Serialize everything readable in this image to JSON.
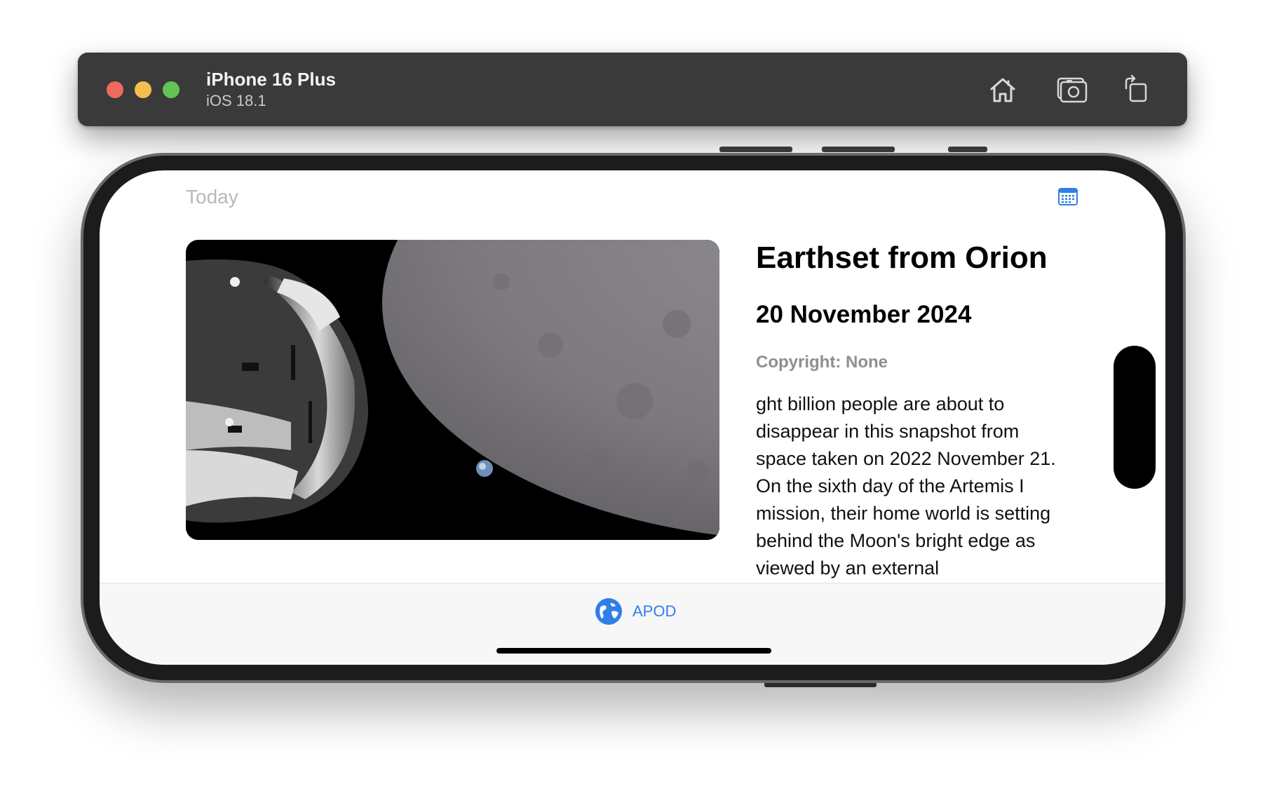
{
  "simulator": {
    "device_name": "iPhone 16 Plus",
    "os_version": "iOS 18.1",
    "buttons": {
      "home_icon": "home-icon",
      "screenshot_icon": "camera-icon",
      "rotate_icon": "rotate-icon"
    },
    "traffic_lights": {
      "close_color": "#ed6a5e",
      "minimize_color": "#f4bf4f",
      "zoom_color": "#61c454"
    }
  },
  "app": {
    "nav": {
      "title": "Today",
      "calendar_icon": "calendar-icon"
    },
    "apod": {
      "title": "Earthset from Orion",
      "date": "20 November 2024",
      "copyright": "Copyright: None",
      "explanation": "ght billion people are about to disappear in this snapshot from space taken on 2022 November 21. On the sixth day of the Artemis I mission, their home world is setting behind the Moon's bright edge as viewed by an external"
    },
    "tab_bar": {
      "items": [
        {
          "label": "APOD",
          "icon": "globe-icon",
          "selected": true
        }
      ]
    },
    "accent_color": "#2f7fe8"
  }
}
